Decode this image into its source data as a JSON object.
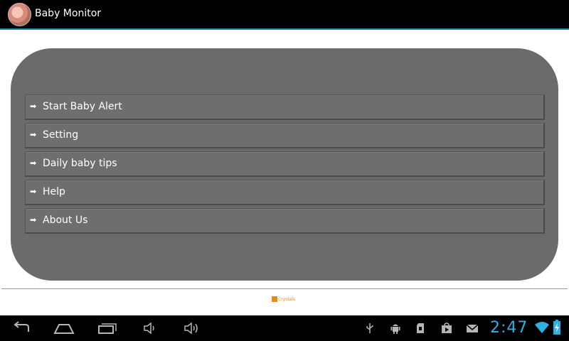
{
  "app": {
    "title": "Baby Monitor"
  },
  "menu": {
    "arrow": "➡",
    "items": [
      {
        "label": "Start Baby Alert"
      },
      {
        "label": "Setting"
      },
      {
        "label": "Daily baby tips"
      },
      {
        "label": "Help"
      },
      {
        "label": "About Us"
      }
    ]
  },
  "footer": {
    "brand_text": "Crystals"
  },
  "system_bar": {
    "time": "2:47",
    "nav_icons": [
      "back-icon",
      "home-icon",
      "recent-apps-icon",
      "volume-down-icon",
      "volume-up-icon"
    ],
    "status_icons": [
      "usb-icon",
      "android-debug-icon",
      "sd-card-icon",
      "store-icon",
      "gmail-icon",
      "wifi-icon",
      "battery-icon"
    ]
  },
  "colors": {
    "action_bar": "#000000",
    "accent_line": "#1e8ab0",
    "panel": "#6b6b6b",
    "clock": "#2fb0e0",
    "brand": "#e58a1f"
  }
}
